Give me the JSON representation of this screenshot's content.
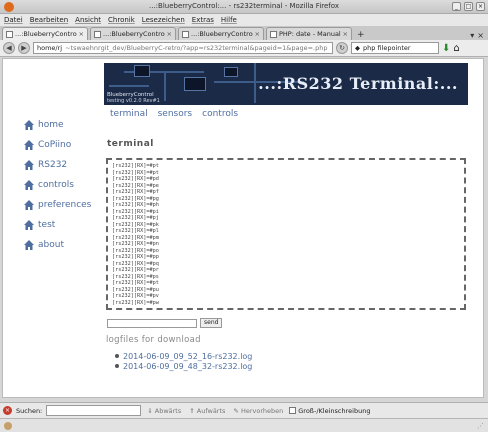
{
  "window": {
    "title": "...:BlueberryControl:... - rs232terminal - Mozilla Firefox"
  },
  "menu": [
    "Datei",
    "Bearbeiten",
    "Ansicht",
    "Chronik",
    "Lesezeichen",
    "Extras",
    "Hilfe"
  ],
  "tabs": [
    {
      "label": "...:BlueberryControl:... - rs2..."
    },
    {
      "label": "...:BlueberryControl:... - rs2..."
    },
    {
      "label": "...:BlueberryControl:... - rs2..."
    },
    {
      "label": "PHP: date - Manual"
    }
  ],
  "nav": {
    "url_host": "home/rj",
    "url_path": "~tswaehnrgit_dev/BlueberryC-retro/?app=rs232terminal&pageid=1&page=.php",
    "search_text": "php filepointer"
  },
  "banner": {
    "title": "...:RS232 Terminal:...",
    "subtitle": "BlueberryControl",
    "subtitle2": "testing v0.2.0 Rev#1"
  },
  "top_nav": [
    "terminal",
    "sensors",
    "controls"
  ],
  "sidebar": [
    "home",
    "CoPiino",
    "RS232",
    "controls",
    "preferences",
    "test",
    "about"
  ],
  "page_title": "terminal",
  "terminal_lines": [
    "[rs232][RX]=#pt",
    "[rs232][RX]=#pt",
    "[rs232][RX]=#pd",
    "[rs232][RX]=#pe",
    "[rs232][RX]=#pf",
    "[rs232][RX]=#pg",
    "[rs232][RX]=#ph",
    "[rs232][RX]=#pi",
    "[rs232][RX]=#pj",
    "[rs232][RX]=#pk",
    "[rs232][RX]=#pl",
    "[rs232][RX]=#pm",
    "[rs232][RX]=#pn",
    "[rs232][RX]=#po",
    "[rs232][RX]=#pp",
    "[rs232][RX]=#pq",
    "[rs232][RX]=#pr",
    "[rs232][RX]=#ps",
    "[rs232][RX]=#pt",
    "[rs232][RX]=#pu",
    "[rs232][RX]=#pv",
    "[rs232][RX]=#pw"
  ],
  "send": {
    "button": "send"
  },
  "logs": {
    "title": "logfiles for download",
    "files": [
      "2014-06-09_09_52_16-rs232.log",
      "2014-06-09_09_48_32-rs232.log"
    ]
  },
  "findbar": {
    "label": "Suchen:",
    "down": "Abwärts",
    "up": "Aufwärts",
    "highlight": "Hervorheben",
    "matchcase": "Groß-/Kleinschreibung"
  }
}
